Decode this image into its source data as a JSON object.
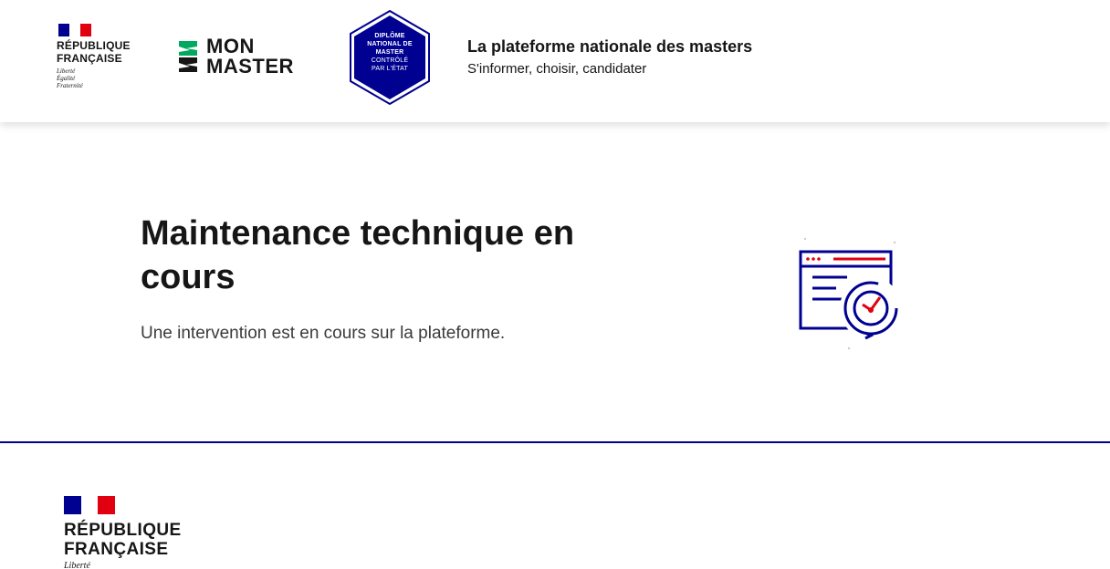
{
  "header": {
    "republic_logo": {
      "line1": "RÉPUBLIQUE",
      "line2": "FRANÇAISE",
      "motto1": "Liberté",
      "motto2": "Égalité",
      "motto3": "Fraternité"
    },
    "monmaster": {
      "line1": "MON",
      "line2": "MASTER"
    },
    "badge": {
      "line1": "DIPLÔME",
      "line2": "NATIONAL DE",
      "line3": "MASTER",
      "line4": "CONTRÔLÉ",
      "line5": "PAR L'ÉTAT"
    },
    "title": "La plateforme nationale des masters",
    "subtitle": "S'informer, choisir, candidater"
  },
  "main": {
    "title": "Maintenance technique en cours",
    "description": "Une intervention est en cours sur la plateforme.",
    "illustration_icon": "maintenance-clock-window-icon"
  },
  "footer": {
    "republic_logo": {
      "line1": "RÉPUBLIQUE",
      "line2": "FRANÇAISE",
      "motto1": "Liberté"
    }
  },
  "colors": {
    "blue_france": "#000091",
    "red_marianne": "#e1000f",
    "monmaster_green": "#00a95f",
    "text": "#161616"
  }
}
